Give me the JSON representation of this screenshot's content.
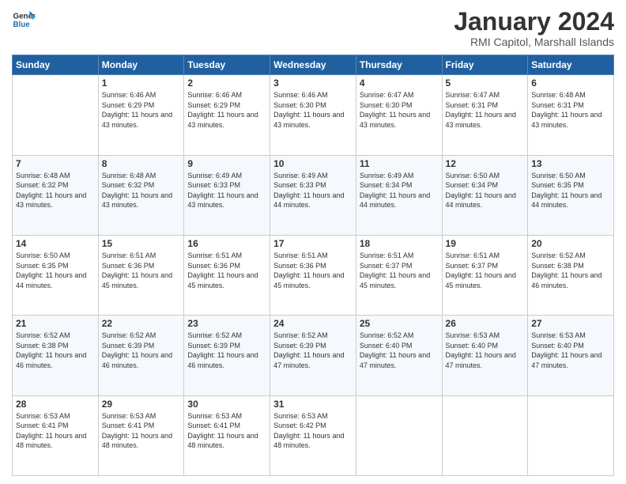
{
  "logo": {
    "line1": "General",
    "line2": "Blue"
  },
  "title": "January 2024",
  "location": "RMI Capitol, Marshall Islands",
  "days_of_week": [
    "Sunday",
    "Monday",
    "Tuesday",
    "Wednesday",
    "Thursday",
    "Friday",
    "Saturday"
  ],
  "weeks": [
    [
      {
        "day": "",
        "sunrise": "",
        "sunset": "",
        "daylight": ""
      },
      {
        "day": "1",
        "sunrise": "Sunrise: 6:46 AM",
        "sunset": "Sunset: 6:29 PM",
        "daylight": "Daylight: 11 hours and 43 minutes."
      },
      {
        "day": "2",
        "sunrise": "Sunrise: 6:46 AM",
        "sunset": "Sunset: 6:29 PM",
        "daylight": "Daylight: 11 hours and 43 minutes."
      },
      {
        "day": "3",
        "sunrise": "Sunrise: 6:46 AM",
        "sunset": "Sunset: 6:30 PM",
        "daylight": "Daylight: 11 hours and 43 minutes."
      },
      {
        "day": "4",
        "sunrise": "Sunrise: 6:47 AM",
        "sunset": "Sunset: 6:30 PM",
        "daylight": "Daylight: 11 hours and 43 minutes."
      },
      {
        "day": "5",
        "sunrise": "Sunrise: 6:47 AM",
        "sunset": "Sunset: 6:31 PM",
        "daylight": "Daylight: 11 hours and 43 minutes."
      },
      {
        "day": "6",
        "sunrise": "Sunrise: 6:48 AM",
        "sunset": "Sunset: 6:31 PM",
        "daylight": "Daylight: 11 hours and 43 minutes."
      }
    ],
    [
      {
        "day": "7",
        "sunrise": "Sunrise: 6:48 AM",
        "sunset": "Sunset: 6:32 PM",
        "daylight": "Daylight: 11 hours and 43 minutes."
      },
      {
        "day": "8",
        "sunrise": "Sunrise: 6:48 AM",
        "sunset": "Sunset: 6:32 PM",
        "daylight": "Daylight: 11 hours and 43 minutes."
      },
      {
        "day": "9",
        "sunrise": "Sunrise: 6:49 AM",
        "sunset": "Sunset: 6:33 PM",
        "daylight": "Daylight: 11 hours and 43 minutes."
      },
      {
        "day": "10",
        "sunrise": "Sunrise: 6:49 AM",
        "sunset": "Sunset: 6:33 PM",
        "daylight": "Daylight: 11 hours and 44 minutes."
      },
      {
        "day": "11",
        "sunrise": "Sunrise: 6:49 AM",
        "sunset": "Sunset: 6:34 PM",
        "daylight": "Daylight: 11 hours and 44 minutes."
      },
      {
        "day": "12",
        "sunrise": "Sunrise: 6:50 AM",
        "sunset": "Sunset: 6:34 PM",
        "daylight": "Daylight: 11 hours and 44 minutes."
      },
      {
        "day": "13",
        "sunrise": "Sunrise: 6:50 AM",
        "sunset": "Sunset: 6:35 PM",
        "daylight": "Daylight: 11 hours and 44 minutes."
      }
    ],
    [
      {
        "day": "14",
        "sunrise": "Sunrise: 6:50 AM",
        "sunset": "Sunset: 6:35 PM",
        "daylight": "Daylight: 11 hours and 44 minutes."
      },
      {
        "day": "15",
        "sunrise": "Sunrise: 6:51 AM",
        "sunset": "Sunset: 6:36 PM",
        "daylight": "Daylight: 11 hours and 45 minutes."
      },
      {
        "day": "16",
        "sunrise": "Sunrise: 6:51 AM",
        "sunset": "Sunset: 6:36 PM",
        "daylight": "Daylight: 11 hours and 45 minutes."
      },
      {
        "day": "17",
        "sunrise": "Sunrise: 6:51 AM",
        "sunset": "Sunset: 6:36 PM",
        "daylight": "Daylight: 11 hours and 45 minutes."
      },
      {
        "day": "18",
        "sunrise": "Sunrise: 6:51 AM",
        "sunset": "Sunset: 6:37 PM",
        "daylight": "Daylight: 11 hours and 45 minutes."
      },
      {
        "day": "19",
        "sunrise": "Sunrise: 6:51 AM",
        "sunset": "Sunset: 6:37 PM",
        "daylight": "Daylight: 11 hours and 45 minutes."
      },
      {
        "day": "20",
        "sunrise": "Sunrise: 6:52 AM",
        "sunset": "Sunset: 6:38 PM",
        "daylight": "Daylight: 11 hours and 46 minutes."
      }
    ],
    [
      {
        "day": "21",
        "sunrise": "Sunrise: 6:52 AM",
        "sunset": "Sunset: 6:38 PM",
        "daylight": "Daylight: 11 hours and 46 minutes."
      },
      {
        "day": "22",
        "sunrise": "Sunrise: 6:52 AM",
        "sunset": "Sunset: 6:39 PM",
        "daylight": "Daylight: 11 hours and 46 minutes."
      },
      {
        "day": "23",
        "sunrise": "Sunrise: 6:52 AM",
        "sunset": "Sunset: 6:39 PM",
        "daylight": "Daylight: 11 hours and 46 minutes."
      },
      {
        "day": "24",
        "sunrise": "Sunrise: 6:52 AM",
        "sunset": "Sunset: 6:39 PM",
        "daylight": "Daylight: 11 hours and 47 minutes."
      },
      {
        "day": "25",
        "sunrise": "Sunrise: 6:52 AM",
        "sunset": "Sunset: 6:40 PM",
        "daylight": "Daylight: 11 hours and 47 minutes."
      },
      {
        "day": "26",
        "sunrise": "Sunrise: 6:53 AM",
        "sunset": "Sunset: 6:40 PM",
        "daylight": "Daylight: 11 hours and 47 minutes."
      },
      {
        "day": "27",
        "sunrise": "Sunrise: 6:53 AM",
        "sunset": "Sunset: 6:40 PM",
        "daylight": "Daylight: 11 hours and 47 minutes."
      }
    ],
    [
      {
        "day": "28",
        "sunrise": "Sunrise: 6:53 AM",
        "sunset": "Sunset: 6:41 PM",
        "daylight": "Daylight: 11 hours and 48 minutes."
      },
      {
        "day": "29",
        "sunrise": "Sunrise: 6:53 AM",
        "sunset": "Sunset: 6:41 PM",
        "daylight": "Daylight: 11 hours and 48 minutes."
      },
      {
        "day": "30",
        "sunrise": "Sunrise: 6:53 AM",
        "sunset": "Sunset: 6:41 PM",
        "daylight": "Daylight: 11 hours and 48 minutes."
      },
      {
        "day": "31",
        "sunrise": "Sunrise: 6:53 AM",
        "sunset": "Sunset: 6:42 PM",
        "daylight": "Daylight: 11 hours and 48 minutes."
      },
      {
        "day": "",
        "sunrise": "",
        "sunset": "",
        "daylight": ""
      },
      {
        "day": "",
        "sunrise": "",
        "sunset": "",
        "daylight": ""
      },
      {
        "day": "",
        "sunrise": "",
        "sunset": "",
        "daylight": ""
      }
    ]
  ]
}
